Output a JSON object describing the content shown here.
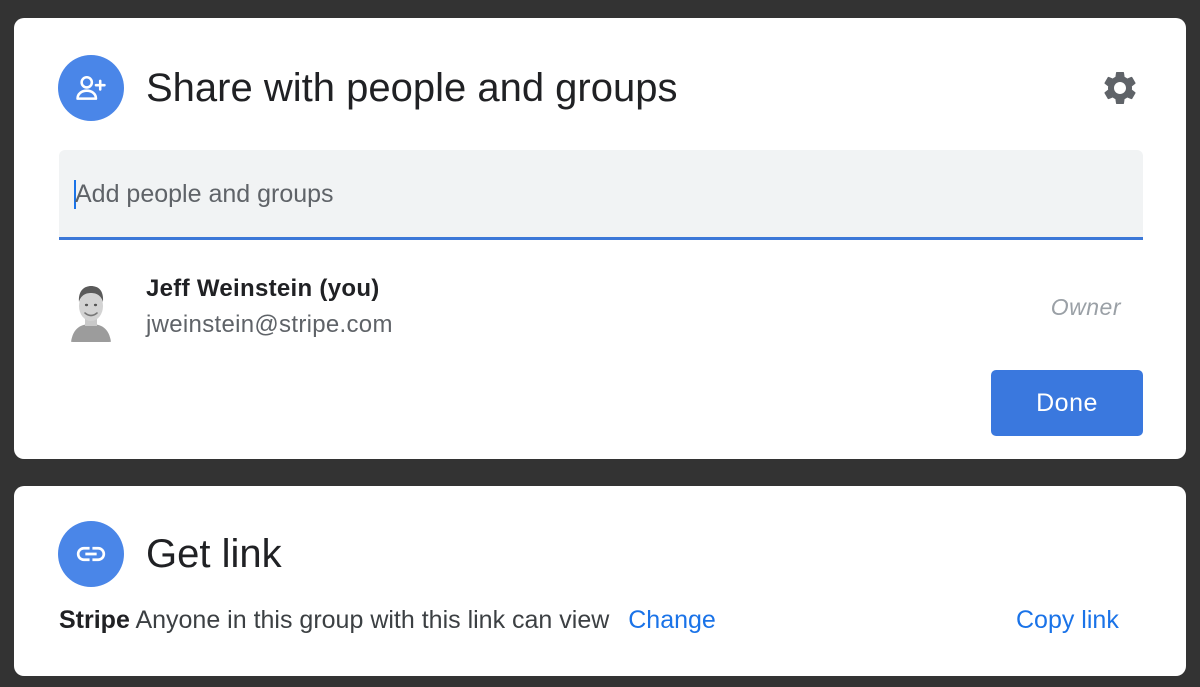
{
  "share_dialog": {
    "title": "Share with people and groups",
    "search": {
      "placeholder": "Add people and groups",
      "value": ""
    },
    "people": [
      {
        "name": "Jeff Weinstein (you)",
        "email": "jweinstein@stripe.com",
        "role": "Owner"
      }
    ],
    "done_label": "Done",
    "icons": {
      "header": "add-person-icon",
      "settings": "gear-icon"
    }
  },
  "link_panel": {
    "title": "Get link",
    "group_name": "Stripe",
    "description": "Anyone in this group with this link can view",
    "change_label": "Change",
    "copy_label": "Copy link",
    "icons": {
      "header": "link-icon"
    }
  },
  "colors": {
    "accent": "#4a86e8",
    "button": "#3a78de",
    "link": "#1a73e8",
    "backdrop": "#333333"
  }
}
